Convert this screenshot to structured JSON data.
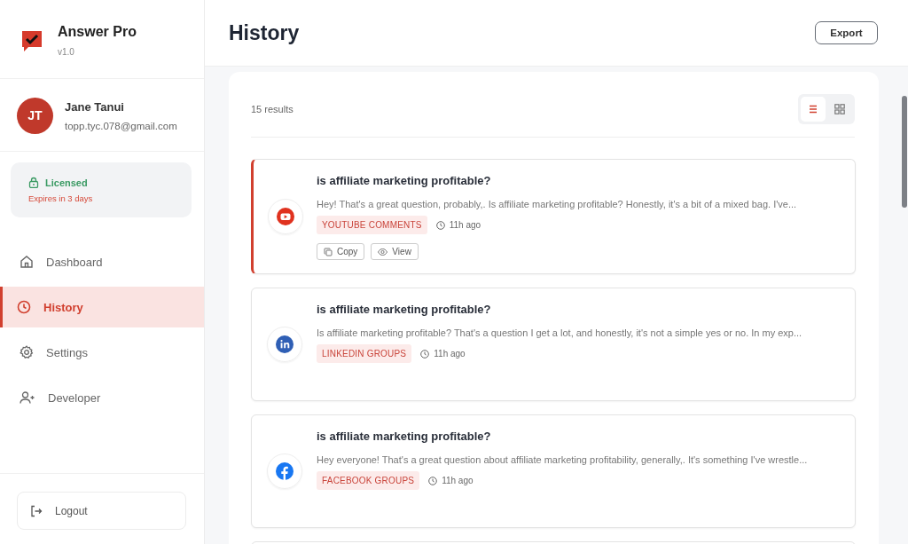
{
  "app": {
    "name": "Answer Pro",
    "version": "v1.0"
  },
  "user": {
    "initials": "JT",
    "name": "Jane Tanui",
    "email": "topp.tyc.078@gmail.com"
  },
  "license": {
    "status": "Licensed",
    "expiry": "Expires in 3 days"
  },
  "nav": [
    {
      "label": "Dashboard",
      "kind": "home",
      "selected": false
    },
    {
      "label": "History",
      "kind": "clock",
      "selected": true
    },
    {
      "label": "Settings",
      "kind": "gear",
      "selected": false
    },
    {
      "label": "Developer",
      "kind": "user",
      "selected": false
    }
  ],
  "logout": "Logout",
  "page": {
    "title": "History",
    "export": "Export"
  },
  "results": "15 results",
  "view_modes": [
    {
      "kind": "list",
      "selected": true
    },
    {
      "kind": "grid",
      "selected": false
    }
  ],
  "items": [
    {
      "kind": "youtube",
      "selected": true,
      "title": "is affiliate marketing profitable?",
      "excerpt": "Hey! That's a great question, probably,. Is affiliate marketing profitable? Honestly, it's a bit of a mixed bag. I've...",
      "tag": "YOUTUBE COMMENTS",
      "time": "11h ago",
      "actions": [
        {
          "kind": "copy",
          "label": "Copy"
        },
        {
          "kind": "view",
          "label": "View"
        }
      ]
    },
    {
      "kind": "linkedin",
      "selected": false,
      "title": "is affiliate marketing profitable?",
      "excerpt": "Is affiliate marketing profitable? That's a question I get a lot, and honestly, it's not a simple yes or no. In my exp...",
      "tag": "LINKEDIN GROUPS",
      "time": "11h ago"
    },
    {
      "kind": "facebook",
      "selected": false,
      "title": "is affiliate marketing profitable?",
      "excerpt": "Hey everyone! That's a great question about affiliate marketing profitability, generally,. It's something I've wrestle...",
      "tag": "FACEBOOK GROUPS",
      "time": "11h ago"
    }
  ]
}
